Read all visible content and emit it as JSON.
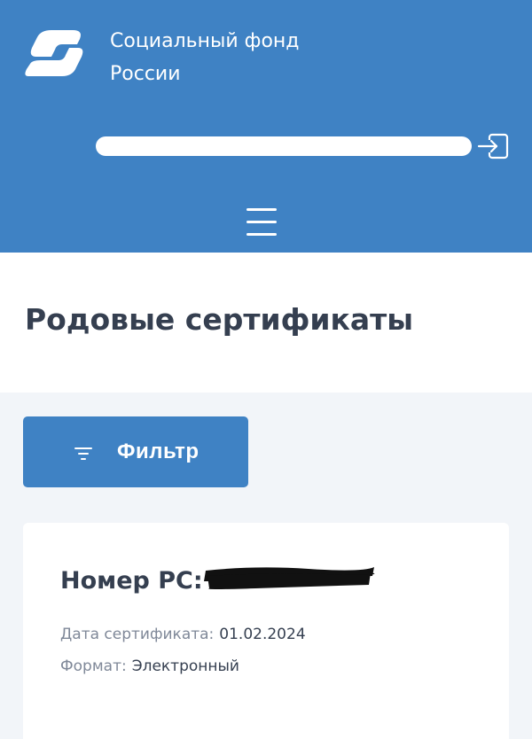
{
  "header": {
    "brand_line1": "Социальный фонд",
    "brand_line2": "России",
    "logo_icon": "sfr-logo-icon",
    "logout_icon": "logout-icon",
    "menu_icon": "hamburger-menu-icon",
    "color": "#3f82c4"
  },
  "page": {
    "title": "Родовые сертификаты"
  },
  "filter": {
    "label": "Фильтр",
    "icon": "filter-icon"
  },
  "certificate": {
    "number_label": "Номер РС:",
    "date_label": "Дата сертификата:",
    "date_value": "01.02.2024",
    "format_label": "Формат:",
    "format_value": "Электронный"
  }
}
